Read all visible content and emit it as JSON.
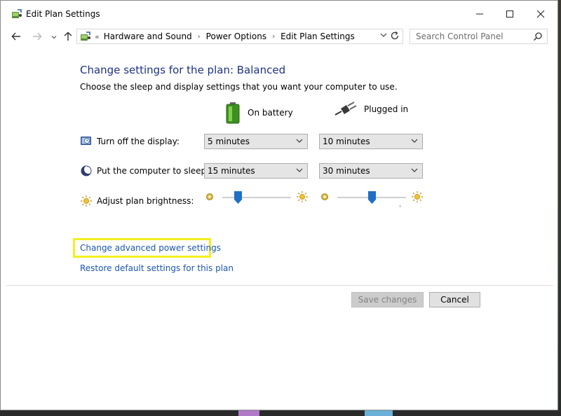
{
  "window": {
    "title": "Edit Plan Settings"
  },
  "address": {
    "breadcrumb": [
      "Hardware and Sound",
      "Power Options",
      "Edit Plan Settings"
    ],
    "prefix": "«"
  },
  "search": {
    "placeholder": "Search Control Panel"
  },
  "content": {
    "heading": "Change settings for the plan: Balanced",
    "subtext": "Choose the sleep and display settings that you want your computer to use.",
    "columns": {
      "battery": "On battery",
      "plugged": "Plugged in"
    },
    "rows": {
      "display": {
        "label": "Turn off the display:",
        "battery_value": "5 minutes",
        "plugged_value": "10 minutes"
      },
      "sleep": {
        "label": "Put the computer to sleep:",
        "battery_value": "15 minutes",
        "plugged_value": "30 minutes"
      },
      "brightness": {
        "label": "Adjust plan brightness:",
        "battery_level": 0.2,
        "plugged_level": 0.5
      }
    }
  },
  "links": {
    "advanced": "Change advanced power settings",
    "restore": "Restore default settings for this plan"
  },
  "buttons": {
    "save": "Save changes",
    "cancel": "Cancel"
  },
  "colors": {
    "heading": "#1e3287",
    "link": "#1a56b5",
    "highlight": "#f4ef1e",
    "slider_thumb": "#1f6fc5"
  },
  "icons": {
    "app": "power-options-icon",
    "display": "monitor-clock-icon",
    "sleep": "moon-icon",
    "brightness": "sun-icon",
    "battery": "battery-icon",
    "plugged": "power-plug-icon"
  }
}
